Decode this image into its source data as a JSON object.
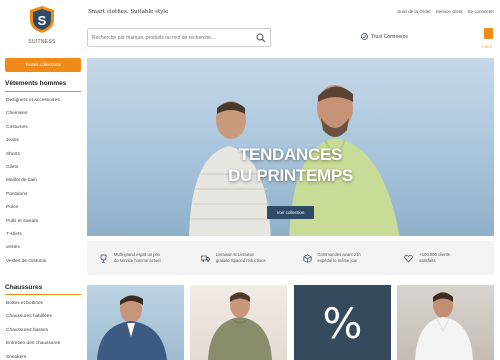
{
  "header": {
    "logo_text": "SUITNESS",
    "tagline": "Smart clothes. Suitable style",
    "top_links": [
      "Suivi de la Order",
      "Service client",
      "Se connecter"
    ],
    "search_placeholder": "Recherche par marque, produits ou mot de recherche...",
    "trust_label": "Trust Commerce",
    "cart_label": "0.00 €"
  },
  "sidebar": {
    "collections_button": "Toutes collections",
    "section1_title": "Vêtements hommes",
    "section1_items": [
      "Designers et accessoires",
      "Chemises",
      "Costumes",
      "Jeans",
      "Shorts",
      "Gilets",
      "Maillot de bain",
      "Pantalons",
      "Polos",
      "Pulls et sweats",
      "T-shirts",
      "vestes",
      "Vestes de costume"
    ],
    "section2_title": "Chaussures",
    "section2_items": [
      "Bottes et bottines",
      "Chaussures habillées",
      "Chaussures basses",
      "Entretien des chaussures",
      "Sneakers"
    ]
  },
  "hero": {
    "title_line1": "TENDANCES",
    "title_line2": "DU PRINTEMPS",
    "button_label": "Voir collection"
  },
  "features": [
    {
      "icon": "trophy-icon",
      "line1": "Multi-grand esprit un prix",
      "line2": "de service homme actuel"
    },
    {
      "icon": "truck-icon",
      "line1": "Livraison & Livraison",
      "line2": "gratuite Spaced réductions"
    },
    {
      "icon": "box-icon",
      "line1": "Commandes avant 21h",
      "line2": "expédié le même jour"
    },
    {
      "icon": "heart-icon",
      "line1": "+100.000 clients",
      "line2": "satisfaits"
    }
  ],
  "tiles": {
    "sale_symbol": "%"
  },
  "colors": {
    "accent": "#f08a19",
    "navy": "#2f4a64"
  }
}
